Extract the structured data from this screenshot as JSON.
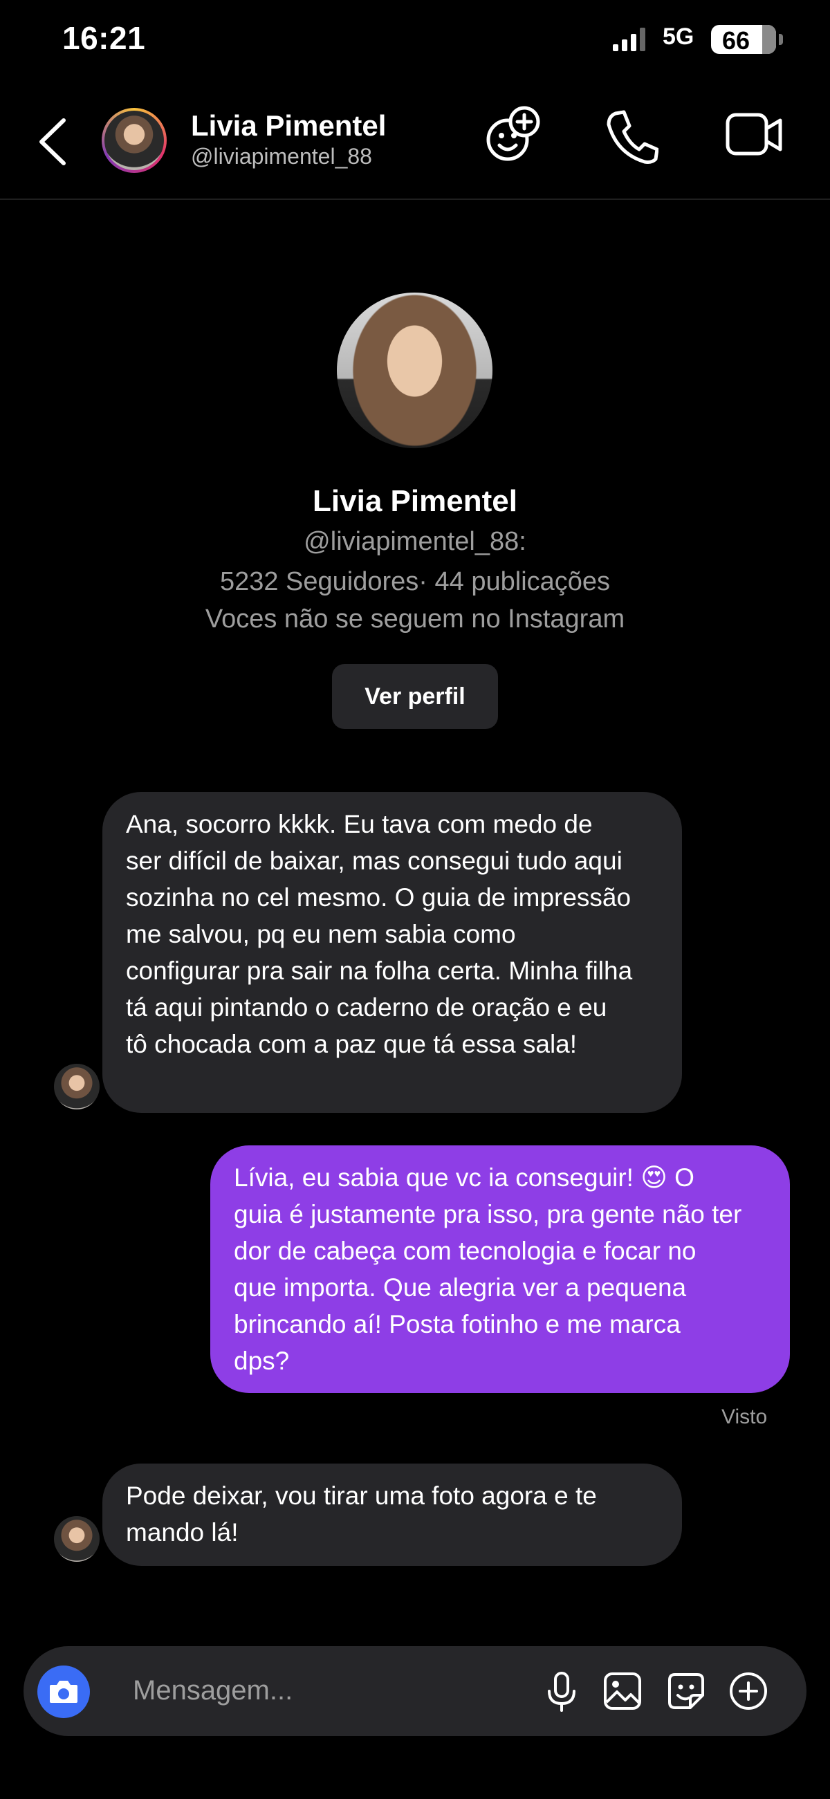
{
  "status_bar": {
    "time": "16:21",
    "network": "5G",
    "battery": "66"
  },
  "header": {
    "name": "Livia Pimentel",
    "username": "@liviapimentel_88",
    "icons": [
      "back-icon",
      "add-emoji-icon",
      "phone-icon",
      "video-icon"
    ]
  },
  "profile": {
    "name": "Livia Pimentel",
    "username": "@liviapimentel_88:",
    "stats": "5232 Seguidores· 44 publicações",
    "note": "Voces não se seguem no Instagram",
    "button": "Ver perfil"
  },
  "messages": [
    {
      "from": "them",
      "lines": [
        "Ana, socorro kkkk. Eu tava com medo de",
        "ser difícil de baixar, mas consegui tudo aqui",
        "sozinha no cel mesmo. O guia de impressão",
        "me salvou, pq eu nem sabia como",
        "configurar pra sair na folha certa. Minha filha",
        "tá aqui pintando o caderno de oração e eu",
        "tô chocada com a paz que tá essa sala!"
      ]
    },
    {
      "from": "me",
      "lines": [
        "Lívia, eu sabia que vc ia conseguir! 😍 O",
        "guia é justamente pra isso, pra gente não ter",
        "dor de cabeça com tecnologia e focar no",
        "que importa. Que alegria ver a pequena",
        "brincando aí! Posta fotinho e me marca",
        "dps?"
      ]
    },
    {
      "from": "them",
      "lines": [
        "Pode deixar, vou tirar uma foto agora e te",
        "mando lá!"
      ]
    }
  ],
  "seen_label": "Visto",
  "composer": {
    "placeholder": "Mensagem...",
    "icons": [
      "camera-icon",
      "microphone-icon",
      "image-icon",
      "sticker-icon",
      "plus-icon"
    ]
  },
  "colors": {
    "accent_bubble": "#8e3ee6",
    "incoming_bubble": "#262629",
    "camera_button": "#3a6cf5"
  }
}
